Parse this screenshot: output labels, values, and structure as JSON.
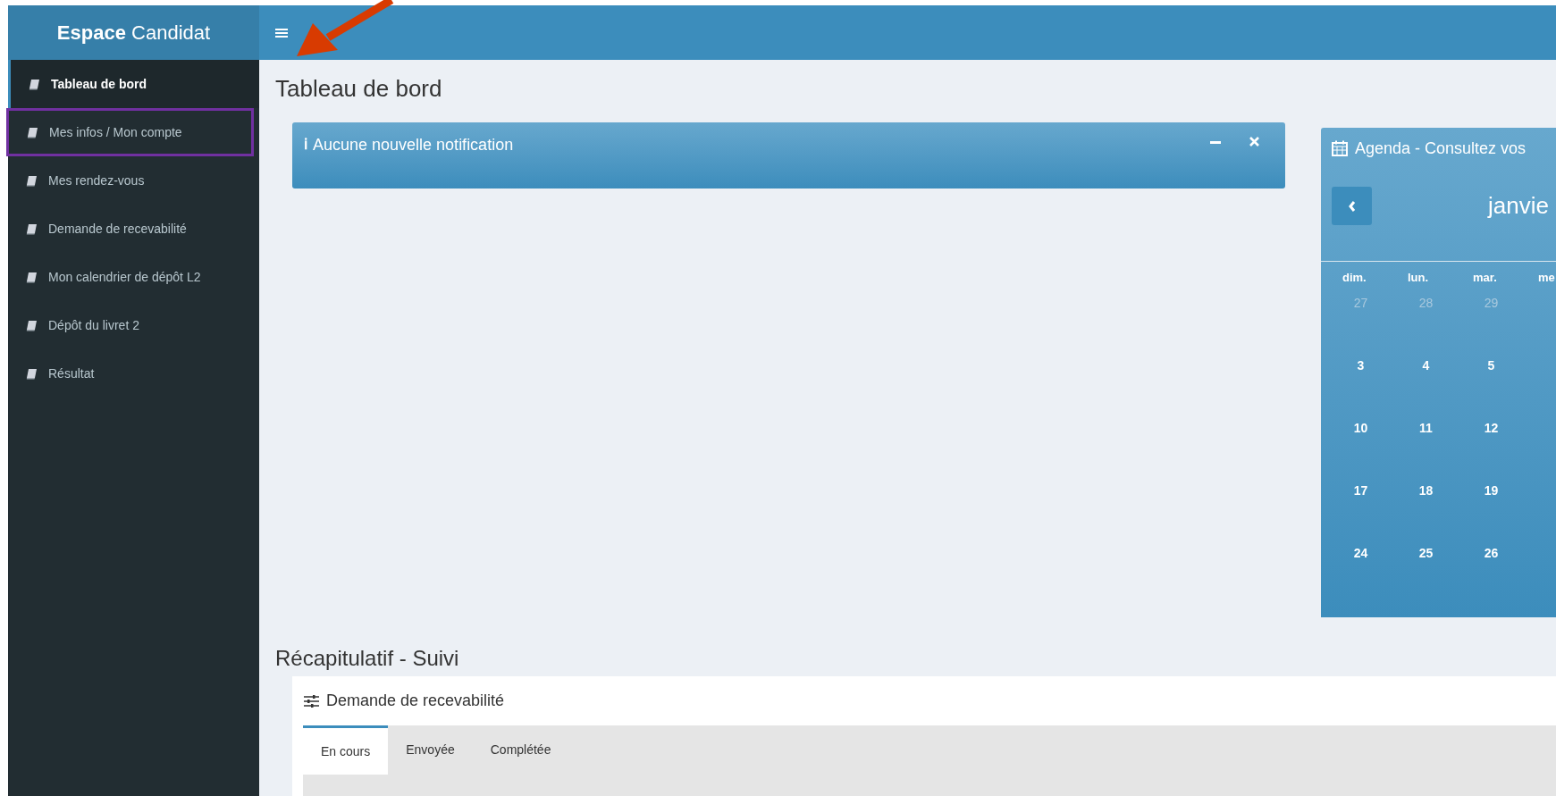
{
  "sidebar": {
    "brand_bold": "Espace",
    "brand_light": "Candidat",
    "items": [
      {
        "label": "Tableau de bord",
        "selected": true,
        "highlighted": false
      },
      {
        "label": "Mes infos / Mon compte",
        "selected": false,
        "highlighted": true
      },
      {
        "label": "Mes rendez-vous",
        "selected": false,
        "highlighted": false
      },
      {
        "label": "Demande de recevabilité",
        "selected": false,
        "highlighted": false
      },
      {
        "label": "Mon calendrier de dépôt L2",
        "selected": false,
        "highlighted": false
      },
      {
        "label": "Dépôt du livret 2",
        "selected": false,
        "highlighted": false
      },
      {
        "label": "Résultat",
        "selected": false,
        "highlighted": false
      }
    ]
  },
  "page_title": "Tableau de bord",
  "notification": {
    "icon": "ℹ",
    "title": "Aucune nouvelle notification"
  },
  "agenda": {
    "title": "Agenda - Consultez vos",
    "month": "janvie",
    "weekdays": [
      "dim.",
      "lun.",
      "mar.",
      "me"
    ],
    "weeks": [
      [
        {
          "day": "27",
          "muted": true
        },
        {
          "day": "28",
          "muted": true
        },
        {
          "day": "29",
          "muted": true
        }
      ],
      [
        {
          "day": "3",
          "muted": false
        },
        {
          "day": "4",
          "muted": false
        },
        {
          "day": "5",
          "muted": false
        }
      ],
      [
        {
          "day": "10",
          "muted": false
        },
        {
          "day": "11",
          "muted": false
        },
        {
          "day": "12",
          "muted": false
        }
      ],
      [
        {
          "day": "17",
          "muted": false
        },
        {
          "day": "18",
          "muted": false
        },
        {
          "day": "19",
          "muted": false
        }
      ],
      [
        {
          "day": "24",
          "muted": false
        },
        {
          "day": "25",
          "muted": false
        },
        {
          "day": "26",
          "muted": false
        }
      ]
    ]
  },
  "summary": {
    "title": "Récapitulatif - Suivi",
    "card_title": "Demande de recevabilité",
    "tabs": [
      {
        "label": "En cours",
        "selected": true
      },
      {
        "label": "Envoyée",
        "selected": false
      },
      {
        "label": "Complétée",
        "selected": false
      }
    ]
  },
  "annotation": {
    "arrow": true
  }
}
